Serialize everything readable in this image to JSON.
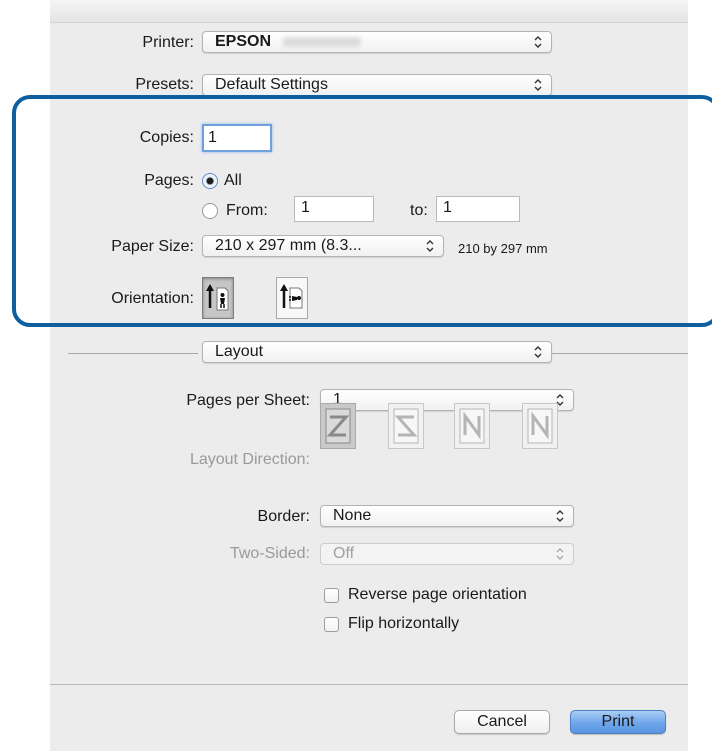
{
  "printer": {
    "label": "Printer:",
    "value": "EPSON"
  },
  "presets": {
    "label": "Presets:",
    "value": "Default Settings"
  },
  "copies": {
    "label": "Copies:",
    "value": "1"
  },
  "pages": {
    "label": "Pages:",
    "all_label": "All",
    "from_label": "From:",
    "from_value": "1",
    "to_label": "to:",
    "to_value": "1",
    "selected": "All"
  },
  "paper_size": {
    "label": "Paper Size:",
    "value": "210 x 297 mm (8.3...",
    "info": "210 by 297 mm"
  },
  "orientation": {
    "label": "Orientation:",
    "options": [
      "portrait",
      "landscape"
    ],
    "selected": "portrait"
  },
  "section": {
    "value": "Layout"
  },
  "layout": {
    "pages_per_sheet_label": "Pages per Sheet:",
    "pages_per_sheet_value": "1",
    "layout_direction_label": "Layout Direction:",
    "layout_directions": [
      "Z",
      "S",
      "N-reverse",
      "N"
    ],
    "border_label": "Border:",
    "border_value": "None",
    "two_sided_label": "Two-Sided:",
    "two_sided_value": "Off",
    "reverse_label": "Reverse page orientation",
    "reverse_checked": false,
    "flip_label": "Flip horizontally",
    "flip_checked": false
  },
  "buttons": {
    "cancel": "Cancel",
    "print": "Print"
  },
  "colors": {
    "accent": "#0d5fa0",
    "default_button": "#6fa5ea",
    "dialog_bg": "#ececec"
  }
}
